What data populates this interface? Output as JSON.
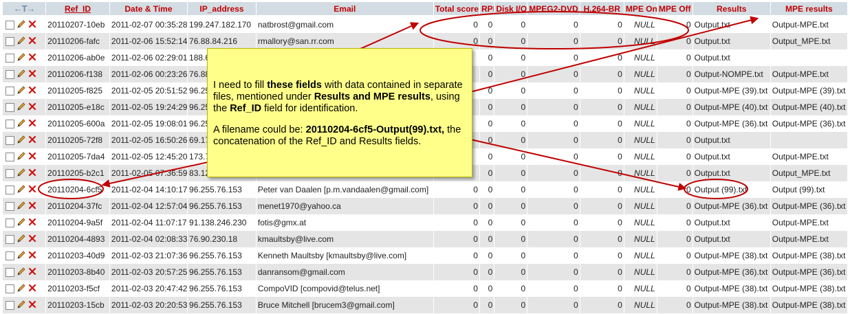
{
  "header": {
    "arrows": "←T→",
    "columns": [
      "Ref_ID",
      "Date & Time",
      "IP_address",
      "Email",
      "Total score",
      "RPI",
      "Disk I/O",
      "MPEG2-DVD",
      "H.264-BR",
      "MPE On",
      "MPE Off",
      "Results",
      "MPE results"
    ]
  },
  "rows": [
    {
      "ref": "20110207-10eb",
      "dt": "2011-02-07 00:35:28",
      "ip": "199.247.182.170",
      "email": "natbrost@gmail.com",
      "total": "0",
      "rpi": "0",
      "disk": "0",
      "mpeg2": "0",
      "h264": "0",
      "mpeon": "NULL",
      "mpeoff": "0",
      "results": "Output.txt",
      "mpe": "Output-MPE.txt"
    },
    {
      "ref": "20110206-fafc",
      "dt": "2011-02-06 15:52:14",
      "ip": "76.88.84.216",
      "email": "rmallory@san.rr.com",
      "total": "0",
      "rpi": "0",
      "disk": "0",
      "mpeg2": "0",
      "h264": "0",
      "mpeon": "NULL",
      "mpeoff": "0",
      "results": "Output.txt",
      "mpe": "Output_MPE.txt"
    },
    {
      "ref": "20110206-ab0e",
      "dt": "2011-02-06 02:29:01",
      "ip": "188.6",
      "email": "",
      "total": "",
      "rpi": "0",
      "disk": "0",
      "mpeg2": "0",
      "h264": "0",
      "mpeon": "NULL",
      "mpeoff": "0",
      "results": "Output.txt",
      "mpe": ""
    },
    {
      "ref": "20110206-f138",
      "dt": "2011-02-06 00:23:26",
      "ip": "76.88",
      "email": "",
      "total": "",
      "rpi": "0",
      "disk": "0",
      "mpeg2": "0",
      "h264": "0",
      "mpeon": "NULL",
      "mpeoff": "0",
      "results": "Output-NOMPE.txt",
      "mpe": "Output-MPE.txt"
    },
    {
      "ref": "20110205-f825",
      "dt": "2011-02-05 20:51:52",
      "ip": "96.25",
      "email": "",
      "total": "",
      "rpi": "0",
      "disk": "0",
      "mpeg2": "0",
      "h264": "0",
      "mpeon": "NULL",
      "mpeoff": "0",
      "results": "Output-MPE (39).txt",
      "mpe": "Output-MPE (39).txt"
    },
    {
      "ref": "20110205-e18c",
      "dt": "2011-02-05 19:24:29",
      "ip": "96.25",
      "email": "",
      "total": "",
      "rpi": "0",
      "disk": "0",
      "mpeg2": "0",
      "h264": "0",
      "mpeon": "NULL",
      "mpeoff": "0",
      "results": "Output-MPE (40).txt",
      "mpe": "Output-MPE (40).txt"
    },
    {
      "ref": "20110205-600a",
      "dt": "2011-02-05 19:08:01",
      "ip": "96.25",
      "email": "",
      "total": "",
      "rpi": "0",
      "disk": "0",
      "mpeg2": "0",
      "h264": "0",
      "mpeon": "NULL",
      "mpeoff": "0",
      "results": "Output-MPE (36).txt",
      "mpe": "Output-MPE (36).txt"
    },
    {
      "ref": "20110205-72f8",
      "dt": "2011-02-05 16:50:26",
      "ip": "69.17",
      "email": "",
      "total": "",
      "rpi": "0",
      "disk": "0",
      "mpeg2": "0",
      "h264": "0",
      "mpeon": "NULL",
      "mpeoff": "0",
      "results": "Output.txt",
      "mpe": ""
    },
    {
      "ref": "20110205-7da4",
      "dt": "2011-02-05 12:45:20",
      "ip": "173.7",
      "email": "",
      "total": "",
      "rpi": "0",
      "disk": "0",
      "mpeg2": "0",
      "h264": "0",
      "mpeon": "NULL",
      "mpeoff": "0",
      "results": "Output.txt",
      "mpe": "Output-MPE.txt"
    },
    {
      "ref": "20110205-b2c1",
      "dt": "2011-02-05 07:36:59",
      "ip": "83.12",
      "email": "",
      "total": "",
      "rpi": "0",
      "disk": "0",
      "mpeg2": "0",
      "h264": "0",
      "mpeon": "NULL",
      "mpeoff": "0",
      "results": "Output.txt",
      "mpe": "Output_MPE.txt"
    },
    {
      "ref": "20110204-6cf5",
      "dt": "2011-02-04 14:10:17",
      "ip": "96.255.76.153",
      "email": "Peter van Daalen [p.m.vandaalen@gmail.com]",
      "total": "0",
      "rpi": "0",
      "disk": "0",
      "mpeg2": "0",
      "h264": "0",
      "mpeon": "NULL",
      "mpeoff": "0",
      "results": "Output (99).txt",
      "mpe": "Output (99).txt"
    },
    {
      "ref": "20110204-37fc",
      "dt": "2011-02-04 12:57:04",
      "ip": "96.255.76.153",
      "email": "menet1970@yahoo.ca",
      "total": "0",
      "rpi": "0",
      "disk": "0",
      "mpeg2": "0",
      "h264": "0",
      "mpeon": "NULL",
      "mpeoff": "0",
      "results": "Output-MPE (36).txt",
      "mpe": "Output-MPE (36).txt"
    },
    {
      "ref": "20110204-9a5f",
      "dt": "2011-02-04 11:07:17",
      "ip": "91.138.246.230",
      "email": "fotis@gmx.at",
      "total": "0",
      "rpi": "0",
      "disk": "0",
      "mpeg2": "0",
      "h264": "0",
      "mpeon": "NULL",
      "mpeoff": "0",
      "results": "Output.txt",
      "mpe": "Output-MPE.txt"
    },
    {
      "ref": "20110204-4893",
      "dt": "2011-02-04 02:08:33",
      "ip": "76.90.230.18",
      "email": "kmaultsby@live.com",
      "total": "0",
      "rpi": "0",
      "disk": "0",
      "mpeg2": "0",
      "h264": "0",
      "mpeon": "NULL",
      "mpeoff": "0",
      "results": "Output.txt",
      "mpe": "Output-MPE.txt"
    },
    {
      "ref": "20110203-40d9",
      "dt": "2011-02-03 21:07:36",
      "ip": "96.255.76.153",
      "email": "Kenneth Maultsby [kmaultsby@live.com]",
      "total": "0",
      "rpi": "0",
      "disk": "0",
      "mpeg2": "0",
      "h264": "0",
      "mpeon": "NULL",
      "mpeoff": "0",
      "results": "Output-MPE (38).txt",
      "mpe": "Output-MPE (38).txt"
    },
    {
      "ref": "20110203-8b40",
      "dt": "2011-02-03 20:57:25",
      "ip": "96.255.76.153",
      "email": "danransom@gmail.com",
      "total": "0",
      "rpi": "0",
      "disk": "0",
      "mpeg2": "0",
      "h264": "0",
      "mpeon": "NULL",
      "mpeoff": "0",
      "results": "Output-MPE (36).txt",
      "mpe": "Output-MPE (36).txt"
    },
    {
      "ref": "20110203-f5cf",
      "dt": "2011-02-03 20:47:42",
      "ip": "96.255.76.153",
      "email": "CompoVID [compovid@telus.net]",
      "total": "0",
      "rpi": "0",
      "disk": "0",
      "mpeg2": "0",
      "h264": "0",
      "mpeon": "NULL",
      "mpeoff": "0",
      "results": "Output-MPE (38).txt",
      "mpe": "Output-MPE (38).txt"
    },
    {
      "ref": "20110203-15cb",
      "dt": "2011-02-03 20:20:53",
      "ip": "96.255.76.153",
      "email": "Bruce Mitchell [brucem3@gmail.com]",
      "total": "0",
      "rpi": "0",
      "disk": "0",
      "mpeg2": "0",
      "h264": "0",
      "mpeon": "NULL",
      "mpeoff": "0",
      "results": "Output-MPE (38).txt",
      "mpe": "Output-MPE (38).txt"
    }
  ],
  "note": {
    "p1_a": "I need to fill ",
    "p1_b": "these fields",
    "p1_c": " with data contained in separate files, mentioned under ",
    "p1_d": "Results and MPE results",
    "p1_e": ", using the ",
    "p1_f": "Ref_ID",
    "p1_g": " field for identification.",
    "p2_a": "A filename could be: ",
    "p2_b": "20110204-6cf5-Output(99).txt,",
    "p2_c": " the concatenation of the Ref_ID and Results fields."
  },
  "colors": {
    "header_bg": "#d3dce3",
    "header_text": "#c00000",
    "row_alt": "#e5e5e5",
    "note_bg": "#ffff8a",
    "annotation_red": "#c00000"
  },
  "icons": {
    "edit": "pencil-icon",
    "delete": "delete-icon",
    "checkbox": "checkbox"
  }
}
